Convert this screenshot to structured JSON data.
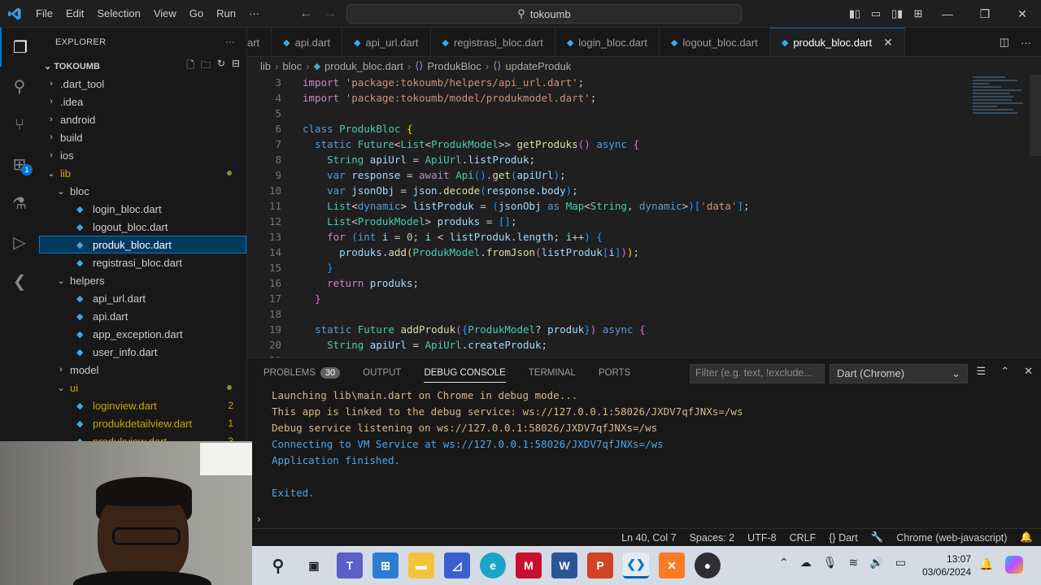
{
  "titlebar": {
    "menu": [
      "File",
      "Edit",
      "Selection",
      "View",
      "Go",
      "Run",
      "···"
    ],
    "search": "tokoumb"
  },
  "explorer": {
    "header": "EXPLORER",
    "project": "TOKOUMB",
    "tree": [
      {
        "label": ".dart_tool",
        "type": "folder",
        "indent": 1,
        "open": false
      },
      {
        "label": ".idea",
        "type": "folder",
        "indent": 1,
        "open": false
      },
      {
        "label": "android",
        "type": "folder",
        "indent": 1,
        "open": false
      },
      {
        "label": "build",
        "type": "folder",
        "indent": 1,
        "open": false
      },
      {
        "label": "ios",
        "type": "folder",
        "indent": 1,
        "open": false
      },
      {
        "label": "lib",
        "type": "folder",
        "indent": 1,
        "open": true,
        "dot": true,
        "warn": true
      },
      {
        "label": "bloc",
        "type": "folder",
        "indent": 2,
        "open": true
      },
      {
        "label": "login_bloc.dart",
        "type": "file",
        "indent": 3
      },
      {
        "label": "logout_bloc.dart",
        "type": "file",
        "indent": 3
      },
      {
        "label": "produk_bloc.dart",
        "type": "file",
        "indent": 3,
        "selected": true
      },
      {
        "label": "registrasi_bloc.dart",
        "type": "file",
        "indent": 3
      },
      {
        "label": "helpers",
        "type": "folder",
        "indent": 2,
        "open": true
      },
      {
        "label": "api_url.dart",
        "type": "file",
        "indent": 3
      },
      {
        "label": "api.dart",
        "type": "file",
        "indent": 3
      },
      {
        "label": "app_exception.dart",
        "type": "file",
        "indent": 3
      },
      {
        "label": "user_info.dart",
        "type": "file",
        "indent": 3
      },
      {
        "label": "model",
        "type": "folder",
        "indent": 2,
        "open": false
      },
      {
        "label": "ui",
        "type": "folder",
        "indent": 2,
        "open": true,
        "dot": true,
        "warn": true
      },
      {
        "label": "loginview.dart",
        "type": "file",
        "indent": 3,
        "count": "2",
        "warn": true
      },
      {
        "label": "produkdetailview.dart",
        "type": "file",
        "indent": 3,
        "count": "1",
        "warn": true
      },
      {
        "label": "produkview.dart",
        "type": "file",
        "indent": 3,
        "count": "3",
        "warn": true
      }
    ]
  },
  "tabs": [
    {
      "label": "art",
      "active": false,
      "partial": true
    },
    {
      "label": "api.dart",
      "active": false
    },
    {
      "label": "api_url.dart",
      "active": false
    },
    {
      "label": "registrasi_bloc.dart",
      "active": false
    },
    {
      "label": "login_bloc.dart",
      "active": false
    },
    {
      "label": "logout_bloc.dart",
      "active": false
    },
    {
      "label": "produk_bloc.dart",
      "active": true
    }
  ],
  "breadcrumb": [
    "lib",
    "bloc",
    "produk_bloc.dart",
    "ProdukBloc",
    "updateProduk"
  ],
  "editor": {
    "lines": [
      {
        "n": "3",
        "html": "<span class='kw2'>import</span> <span class='st'>'package:tokoumb/helpers/api_url.dart'</span>;"
      },
      {
        "n": "4",
        "html": "<span class='kw2'>import</span> <span class='st'>'package:tokoumb/model/produkmodel.dart'</span>;"
      },
      {
        "n": "5",
        "html": ""
      },
      {
        "n": "6",
        "html": "<span class='kw'>class</span> <span class='ty'>ProdukBloc</span> <span class='br3'>{</span>"
      },
      {
        "n": "7",
        "html": "  <span class='kw'>static</span> <span class='ty'>Future</span>&lt;<span class='ty'>List</span>&lt;<span class='ty'>ProdukModel</span>&gt;&gt; <span class='fn'>getProduks</span><span class='br'>()</span> <span class='kw'>async</span> <span class='br'>{</span>"
      },
      {
        "n": "8",
        "html": "    <span class='ty'>String</span> <span class='vr'>apiUrl</span> = <span class='ty'>ApiUrl</span>.<span class='vr'>listProduk</span>;"
      },
      {
        "n": "9",
        "html": "    <span class='kw'>var</span> <span class='vr'>response</span> = <span class='kw2'>await</span> <span class='ty'>Api</span><span class='br2'>()</span>.<span class='fn'>get</span><span class='br2'>(</span><span class='vr'>apiUrl</span><span class='br2'>)</span>;"
      },
      {
        "n": "10",
        "html": "    <span class='kw'>var</span> <span class='vr'>jsonObj</span> = <span class='vr'>json</span>.<span class='fn'>decode</span><span class='br2'>(</span><span class='vr'>response</span>.<span class='vr'>body</span><span class='br2'>)</span>;"
      },
      {
        "n": "11",
        "html": "    <span class='ty'>List</span>&lt;<span class='kw'>dynamic</span>&gt; <span class='vr'>listProduk</span> = <span class='br2'>(</span><span class='vr'>jsonObj</span> <span class='kw'>as</span> <span class='ty'>Map</span>&lt;<span class='ty'>String</span>, <span class='kw'>dynamic</span>&gt;<span class='br2'>)[</span><span class='st'>'data'</span><span class='br2'>]</span>;"
      },
      {
        "n": "12",
        "html": "    <span class='ty'>List</span>&lt;<span class='ty'>ProdukModel</span>&gt; <span class='vr'>produks</span> = <span class='br2'>[]</span>;"
      },
      {
        "n": "13",
        "html": "    <span class='kw2'>for</span> <span class='br2'>(</span><span class='kw'>int</span> <span class='vr'>i</span> = <span class='nm'>0</span>; <span class='vr'>i</span> &lt; <span class='vr'>listProduk</span>.<span class='vr'>length</span>; <span class='vr'>i</span>++<span class='br2'>)</span> <span class='br2'>{</span>"
      },
      {
        "n": "14",
        "html": "      <span class='vr'>produks</span>.<span class='fn'>add</span><span class='br3'>(</span><span class='ty'>ProdukModel</span>.<span class='fn'>fromJson</span><span class='br'>(</span><span class='vr'>listProduk</span><span class='br2'>[</span><span class='vr'>i</span><span class='br2'>]</span><span class='br'>)</span><span class='br3'>)</span>;"
      },
      {
        "n": "15",
        "html": "    <span class='br2'>}</span>"
      },
      {
        "n": "16",
        "html": "    <span class='kw2'>return</span> <span class='vr'>produks</span>;"
      },
      {
        "n": "17",
        "html": "  <span class='br'>}</span>"
      },
      {
        "n": "18",
        "html": ""
      },
      {
        "n": "19",
        "html": "  <span class='kw'>static</span> <span class='ty'>Future</span> <span class='fn'>addProduk</span><span class='br'>(</span><span class='br2'>{</span><span class='ty'>ProdukModel</span>? <span class='vr'>produk</span><span class='br2'>}</span><span class='br'>)</span> <span class='kw'>async</span> <span class='br'>{</span>"
      },
      {
        "n": "20",
        "html": "    <span class='ty'>String</span> <span class='vr'>apiUrl</span> = <span class='ty'>ApiUrl</span>.<span class='vr'>createProduk</span>;"
      },
      {
        "n": "21",
        "html": ""
      }
    ]
  },
  "panel": {
    "tabs": [
      {
        "label": "PROBLEMS",
        "badge": "30"
      },
      {
        "label": "OUTPUT"
      },
      {
        "label": "DEBUG CONSOLE",
        "active": true
      },
      {
        "label": "TERMINAL"
      },
      {
        "label": "PORTS"
      }
    ],
    "filter_placeholder": "Filter (e.g. text, !exclude...",
    "dropdown": "Dart (Chrome)",
    "console": [
      {
        "text": "Launching lib\\main.dart on Chrome in debug mode...",
        "color": "yellow"
      },
      {
        "text": "This app is linked to the debug service: ws://127.0.0.1:58026/JXDV7qfJNXs=/ws",
        "color": "yellow"
      },
      {
        "text": "Debug service listening on ws://127.0.0.1:58026/JXDV7qfJNXs=/ws",
        "color": "yellow"
      },
      {
        "text": "Connecting to VM Service at ws://127.0.0.1:58026/JXDV7qfJNXs=/ws",
        "color": "blue"
      },
      {
        "text": "Application finished.",
        "color": "blue"
      },
      {
        "text": "",
        "color": "blue"
      },
      {
        "text": "Exited.",
        "color": "blue"
      }
    ]
  },
  "statusbar": {
    "position": "Ln 40, Col 7",
    "spaces": "Spaces: 2",
    "encoding": "UTF-8",
    "eol": "CRLF",
    "language": "{} Dart",
    "device": "Chrome (web-javascript)"
  },
  "taskbar": {
    "time": "13:07",
    "date": "03/06/2024"
  }
}
